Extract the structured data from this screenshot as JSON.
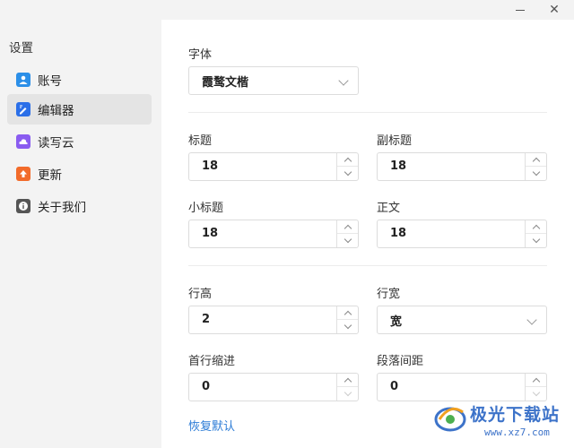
{
  "window": {
    "minimize_glyph": "—",
    "close_glyph": "✕"
  },
  "sidebar": {
    "title": "设置",
    "items": [
      {
        "label": "账号",
        "icon": "user-icon",
        "color": "#2b8fe8",
        "active": false
      },
      {
        "label": "编辑器",
        "icon": "editor-icon",
        "color": "#2b6fe8",
        "active": true
      },
      {
        "label": "读写云",
        "icon": "cloud-icon",
        "color": "#8a5cf0",
        "active": false
      },
      {
        "label": "更新",
        "icon": "update-icon",
        "color": "#f26b2a",
        "active": false
      },
      {
        "label": "关于我们",
        "icon": "info-icon",
        "color": "#555555",
        "active": false
      }
    ]
  },
  "editor": {
    "font": {
      "label": "字体",
      "value": "霞鹜文楷"
    },
    "title_size": {
      "label": "标题",
      "value": "18"
    },
    "subtitle_size": {
      "label": "副标题",
      "value": "18"
    },
    "small_title_size": {
      "label": "小标题",
      "value": "18"
    },
    "body_size": {
      "label": "正文",
      "value": "18"
    },
    "line_height": {
      "label": "行高",
      "value": "2"
    },
    "line_width": {
      "label": "行宽",
      "value": "宽"
    },
    "first_indent": {
      "label": "首行缩进",
      "value": "0"
    },
    "paragraph_spacing": {
      "label": "段落间距",
      "value": "0"
    },
    "reset_link": "恢复默认"
  },
  "watermark": {
    "text": "极光下载站",
    "url": "www.xz7.com"
  }
}
